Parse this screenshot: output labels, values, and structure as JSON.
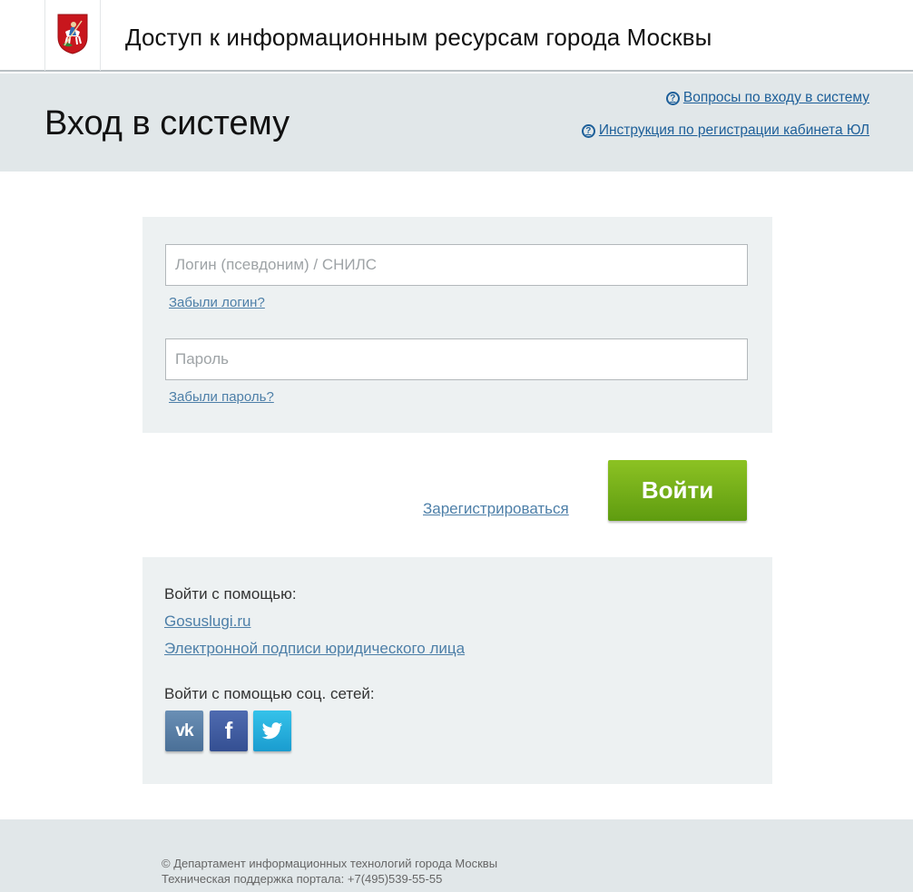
{
  "header": {
    "title": "Доступ к информационным ресурсам города Москвы",
    "logo_icon": "moscow-coat-of-arms-icon"
  },
  "banner": {
    "page_title": "Вход в систему",
    "help_links": [
      {
        "label": "Вопросы по входу в систему",
        "icon": "question-circle-icon"
      },
      {
        "label": "Инструкция по регистрации кабинета ЮЛ",
        "icon": "question-circle-icon"
      }
    ]
  },
  "login_form": {
    "login": {
      "placeholder": "Логин (псевдоним) / СНИЛС",
      "value": ""
    },
    "forgot_login": "Забыли логин?",
    "password": {
      "placeholder": "Пароль",
      "value": ""
    },
    "forgot_password": "Забыли пароль?"
  },
  "actions": {
    "register_label": "Зарегистрироваться",
    "enter_label": "Войти"
  },
  "alt_login": {
    "heading": "Войти с помощью:",
    "links": [
      "Gosuslugi.ru",
      "Электронной подписи юридического лица"
    ],
    "social_heading": "Войти с помощью соц. сетей:",
    "social": [
      {
        "label": "vk",
        "icon": "vk-icon"
      },
      {
        "label": "f",
        "icon": "facebook-icon"
      },
      {
        "label": "",
        "icon": "twitter-icon"
      }
    ]
  },
  "footer": {
    "copyright": "© Департамент информационных технологий города Москвы",
    "support": "Техническая поддержка портала: +7(495)539-55-55"
  },
  "colors": {
    "link": "#4d7fa8",
    "help_link": "#1d5f99",
    "enter_button": "#7ab51d",
    "panel_bg": "#edf1f2",
    "banner_bg": "#e1e7e9"
  }
}
